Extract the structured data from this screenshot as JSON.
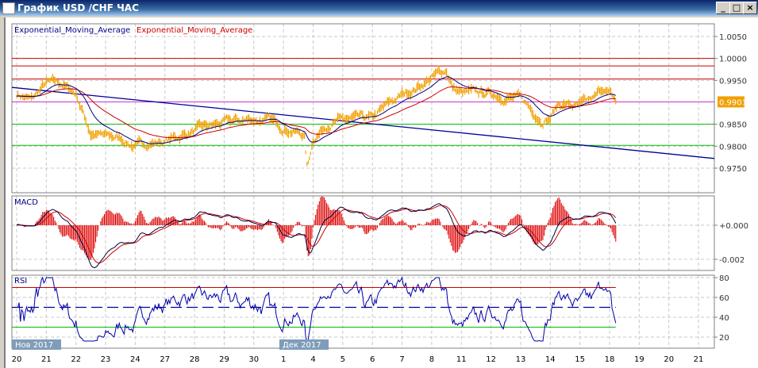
{
  "window": {
    "title": "График USD /CHF  ЧАС",
    "minimize": "_",
    "maximize": "□",
    "close": "×"
  },
  "main_panel": {
    "legend": [
      "Exponential_Moving_Average",
      "Exponential_Moving_Average"
    ],
    "price_ticks": [
      "1.0050",
      "1.0000",
      "0.9950",
      "0.9850",
      "0.9800",
      "0.9750"
    ],
    "current_price": "0.9901"
  },
  "macd_panel": {
    "title": "MACD",
    "ticks": [
      "+0.000",
      "-0.002"
    ]
  },
  "rsi_panel": {
    "title": "RSI",
    "ticks": [
      "80",
      "60",
      "40",
      "20"
    ]
  },
  "time_axis": {
    "months": [
      "Нов 2017",
      "Дек 2017"
    ],
    "days": [
      "20",
      "21",
      "22",
      "23",
      "24",
      "27",
      "28",
      "29",
      "30",
      "1",
      "4",
      "5",
      "6",
      "7",
      "8",
      "11",
      "12",
      "13",
      "14",
      "15",
      "18",
      "19",
      "20",
      "21"
    ]
  },
  "colors": {
    "price": "#f0a000",
    "ema_fast": "#000080",
    "ema_slow": "#cc0000",
    "resistance": "#cc0000",
    "support": "#00bb00",
    "current": "#cc33cc",
    "trend": "#000099"
  },
  "chart_data": {
    "type": "line",
    "title": "USD/CHF H1",
    "price_range": [
      0.9725,
      1.0065
    ],
    "horizontal_levels": {
      "red": [
        1.0,
        0.9983,
        0.9953
      ],
      "magenta": [
        0.9901
      ],
      "green": [
        0.985,
        0.9802
      ]
    },
    "trendline": {
      "start": [
        0,
        0.9934
      ],
      "end": [
        23.3,
        0.9772
      ]
    },
    "price_keypoints": [
      [
        0,
        0.992
      ],
      [
        0.5,
        0.9905
      ],
      [
        1,
        0.9943
      ],
      [
        1.5,
        0.9942
      ],
      [
        2,
        0.992
      ],
      [
        2.5,
        0.983
      ],
      [
        3,
        0.9822
      ],
      [
        3.5,
        0.9818
      ],
      [
        4,
        0.9799
      ],
      [
        4.5,
        0.9808
      ],
      [
        5,
        0.9811
      ],
      [
        6,
        0.9835
      ],
      [
        7,
        0.9853
      ],
      [
        8,
        0.9862
      ],
      [
        8.5,
        0.9858
      ],
      [
        9,
        0.9844
      ],
      [
        9.7,
        0.9826
      ],
      [
        9.8,
        0.9748
      ],
      [
        10,
        0.9817
      ],
      [
        10.5,
        0.9853
      ],
      [
        11,
        0.9858
      ],
      [
        12,
        0.9862
      ],
      [
        12.5,
        0.9893
      ],
      [
        13,
        0.9916
      ],
      [
        13.5,
        0.9934
      ],
      [
        14,
        0.9956
      ],
      [
        14.5,
        0.9974
      ],
      [
        14.7,
        0.9934
      ],
      [
        15,
        0.992
      ],
      [
        16,
        0.992
      ],
      [
        16.5,
        0.9913
      ],
      [
        17,
        0.9907
      ],
      [
        17.7,
        0.9862
      ],
      [
        18,
        0.9866
      ],
      [
        18.3,
        0.9898
      ],
      [
        19,
        0.9889
      ],
      [
        19.5,
        0.9907
      ],
      [
        19.8,
        0.9934
      ],
      [
        20.2,
        0.9901
      ]
    ],
    "macd_range": [
      -0.0028,
      0.0012
    ],
    "rsi_levels": [
      70,
      50,
      30
    ],
    "rsi_range": [
      15,
      82
    ]
  }
}
